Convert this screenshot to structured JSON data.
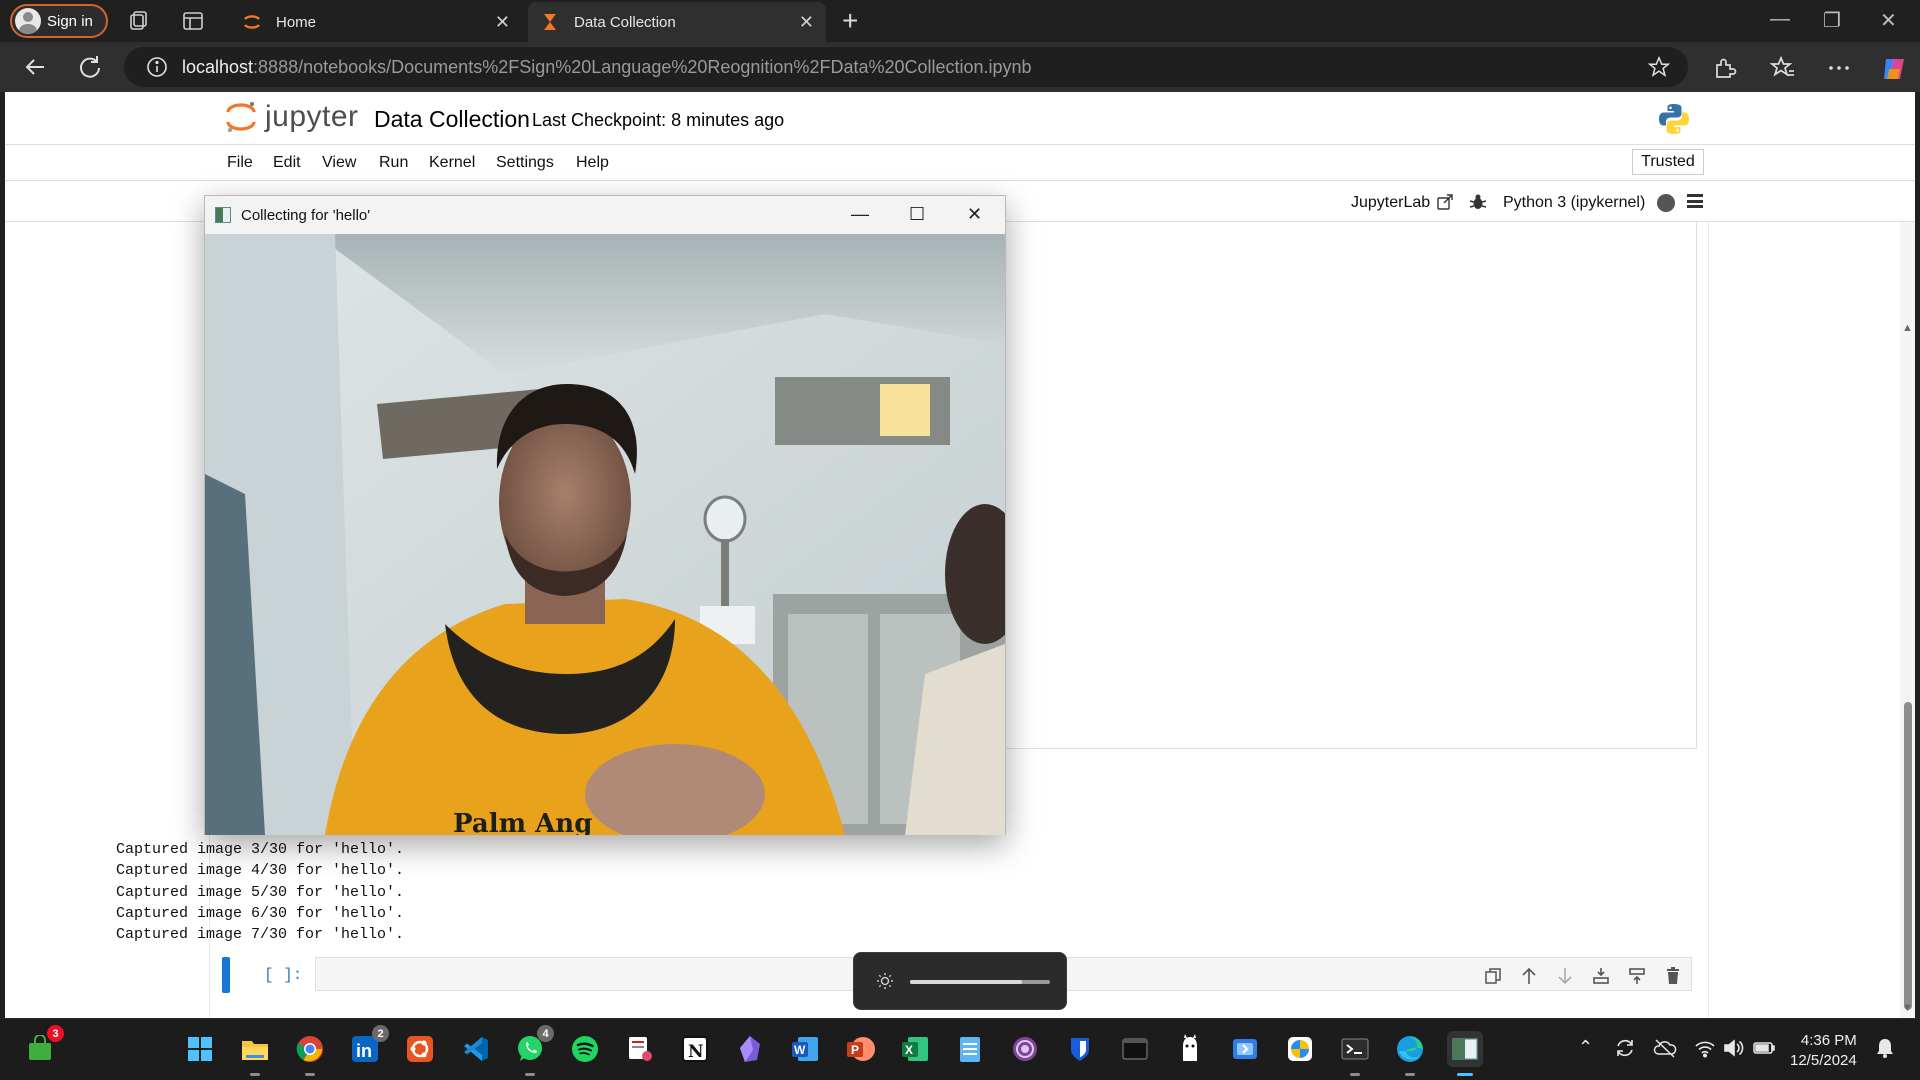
{
  "browser": {
    "signin_label": "Sign in",
    "tabs": [
      {
        "title": "Home",
        "favicon": "jupyter-icon",
        "close": "✕"
      },
      {
        "title": "Data Collection",
        "favicon": "hourglass-icon",
        "close": "✕"
      }
    ],
    "new_tab": "+",
    "window_controls": [
      "—",
      "❐",
      "✕"
    ],
    "url_host": "localhost",
    "url_rest": ":8888/notebooks/Documents%2FSign%20Language%20Reognition%2FData%20Collection.ipynb"
  },
  "jupyter": {
    "logo_text": "jupyter",
    "notebook_title": "Data Collection",
    "checkpoint": "Last Checkpoint: 8 minutes ago",
    "menu": [
      "File",
      "Edit",
      "View",
      "Run",
      "Kernel",
      "Settings",
      "Help"
    ],
    "trusted": "Trusted",
    "jupyterlab_link": "JupyterLab",
    "kernel": "Python 3 (ipykernel)",
    "output_lines": [
      "Captured image 3/30 for 'hello'.",
      "Captured image 4/30 for 'hello'.",
      "Captured image 5/30 for 'hello'.",
      "Captured image 6/30 for 'hello'.",
      "Captured image 7/30 for 'hello'."
    ],
    "cell_prompt": "[ ]:",
    "colors": {
      "accent": "#1976d2",
      "jupyter_orange": "#f37726"
    }
  },
  "cv_window": {
    "title": "Collecting for 'hello'",
    "controls": [
      "—",
      "☐",
      "✕"
    ],
    "webcam_text": "Palm Ang"
  },
  "brightness_flyout": {
    "level_percent": 80
  },
  "taskbar": {
    "apps": [
      {
        "name": "store-app",
        "badge": "3"
      },
      {
        "name": "start-menu"
      },
      {
        "name": "file-explorer"
      },
      {
        "name": "chrome"
      },
      {
        "name": "linkedin",
        "badge": "2"
      },
      {
        "name": "ubuntu"
      },
      {
        "name": "vscode"
      },
      {
        "name": "whatsapp",
        "badge": "4"
      },
      {
        "name": "spotify"
      },
      {
        "name": "snipping-tool"
      },
      {
        "name": "notion"
      },
      {
        "name": "obsidian"
      },
      {
        "name": "word"
      },
      {
        "name": "powerpoint"
      },
      {
        "name": "excel"
      },
      {
        "name": "notepad"
      },
      {
        "name": "tor-browser"
      },
      {
        "name": "bitwarden"
      },
      {
        "name": "terminal"
      },
      {
        "name": "llama-app"
      },
      {
        "name": "photos"
      },
      {
        "name": "pinwheel-app"
      },
      {
        "name": "powershell"
      },
      {
        "name": "edge"
      },
      {
        "name": "opencv-window"
      }
    ],
    "time": "4:36 PM",
    "date": "12/5/2024"
  }
}
